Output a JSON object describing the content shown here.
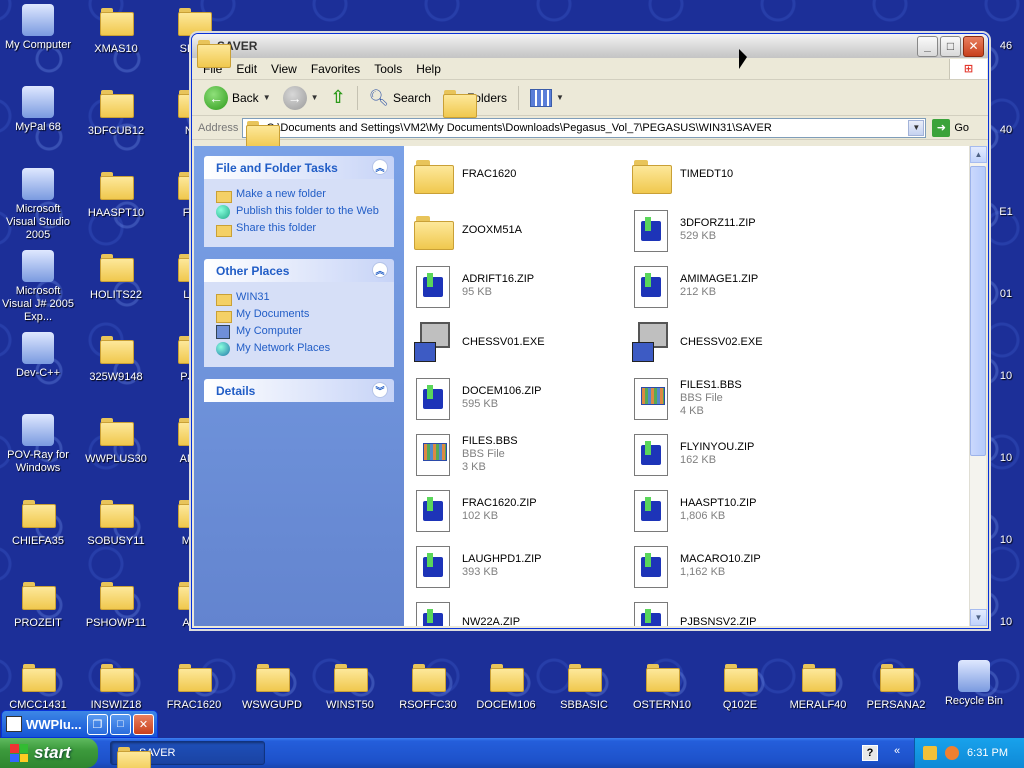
{
  "desktop": {
    "icons": [
      {
        "label": "My Computer"
      },
      {
        "label": "XMAS10"
      },
      {
        "label": "MyPal 68"
      },
      {
        "label": "3DFCUB12"
      },
      {
        "label": "Microsoft Visual Studio 2005"
      },
      {
        "label": "HAASPT10"
      },
      {
        "label": "Microsoft Visual J# 2005 Exp..."
      },
      {
        "label": "HOLITS22"
      },
      {
        "label": "Dev-C++"
      },
      {
        "label": "325W9148"
      },
      {
        "label": "POV-Ray for Windows"
      },
      {
        "label": "WWPLUS30"
      },
      {
        "label": "CHIEFA35"
      },
      {
        "label": "SOBUSY11"
      },
      {
        "label": "PROZEIT"
      },
      {
        "label": "PSHOWP11"
      },
      {
        "label": "CMCC1431"
      },
      {
        "label": "INSWIZ18"
      },
      {
        "label": "FRAC1620"
      },
      {
        "label": "WSWGUPD"
      },
      {
        "label": "WINST50"
      },
      {
        "label": "RSOFFC30"
      },
      {
        "label": "DOCEM106"
      },
      {
        "label": "SBBASIC"
      },
      {
        "label": "OSTERN10"
      },
      {
        "label": "Q102E"
      },
      {
        "label": "MERALF40"
      },
      {
        "label": "PERSANA2"
      },
      {
        "label": "Recycle Bin"
      },
      {
        "label": "SLSH"
      },
      {
        "label": "NW"
      },
      {
        "label": "FLYI"
      },
      {
        "label": "LAU"
      },
      {
        "label": "PJBS"
      },
      {
        "label": "AMIM"
      },
      {
        "label": "MAC"
      },
      {
        "label": "ADR"
      }
    ],
    "right_edge_labels": [
      "46",
      "40",
      "E1",
      "01",
      "10",
      "10",
      "10",
      "10"
    ]
  },
  "window": {
    "title": "SAVER",
    "menu": [
      "File",
      "Edit",
      "View",
      "Favorites",
      "Tools",
      "Help"
    ],
    "toolbar": {
      "back": "Back",
      "search": "Search",
      "folders": "Folders"
    },
    "address": {
      "label": "Address",
      "value": "C:\\Documents and Settings\\VM2\\My Documents\\Downloads\\Pegasus_Vol_7\\PEGASUS\\WIN31\\SAVER",
      "go": "Go"
    },
    "tasks_panel": {
      "title": "File and Folder Tasks",
      "items": [
        "Make a new folder",
        "Publish this folder to the Web",
        "Share this folder"
      ]
    },
    "places_panel": {
      "title": "Other Places",
      "items": [
        "WIN31",
        "My Documents",
        "My Computer",
        "My Network Places"
      ]
    },
    "details_panel": {
      "title": "Details"
    },
    "files": [
      {
        "name": "FRAC1620",
        "type": "folder",
        "meta1": "",
        "meta2": ""
      },
      {
        "name": "TIMEDT10",
        "type": "folder",
        "meta1": "",
        "meta2": ""
      },
      {
        "name": "ZOOXM51A",
        "type": "folder",
        "meta1": "",
        "meta2": ""
      },
      {
        "name": "3DFORZ11.ZIP",
        "type": "zip",
        "meta1": "529 KB",
        "meta2": ""
      },
      {
        "name": "ADRIFT16.ZIP",
        "type": "zip",
        "meta1": "95 KB",
        "meta2": ""
      },
      {
        "name": "AMIMAGE1.ZIP",
        "type": "zip",
        "meta1": "212 KB",
        "meta2": ""
      },
      {
        "name": "CHESSV01.EXE",
        "type": "exe",
        "meta1": "",
        "meta2": ""
      },
      {
        "name": "CHESSV02.EXE",
        "type": "exe",
        "meta1": "",
        "meta2": ""
      },
      {
        "name": "DOCEM106.ZIP",
        "type": "zip",
        "meta1": "595 KB",
        "meta2": ""
      },
      {
        "name": "FILES1.BBS",
        "type": "bbs",
        "meta1": "BBS File",
        "meta2": "4 KB"
      },
      {
        "name": "FILES.BBS",
        "type": "bbs",
        "meta1": "BBS File",
        "meta2": "3 KB"
      },
      {
        "name": "FLYINYOU.ZIP",
        "type": "zip",
        "meta1": "162 KB",
        "meta2": ""
      },
      {
        "name": "FRAC1620.ZIP",
        "type": "zip",
        "meta1": "102 KB",
        "meta2": ""
      },
      {
        "name": "HAASPT10.ZIP",
        "type": "zip",
        "meta1": "1,806 KB",
        "meta2": ""
      },
      {
        "name": "LAUGHPD1.ZIP",
        "type": "zip",
        "meta1": "393 KB",
        "meta2": ""
      },
      {
        "name": "MACARO10.ZIP",
        "type": "zip",
        "meta1": "1,162 KB",
        "meta2": ""
      },
      {
        "name": "NW22A.ZIP",
        "type": "zip",
        "meta1": "",
        "meta2": ""
      },
      {
        "name": "PJBSNSV2.ZIP",
        "type": "zip",
        "meta1": "",
        "meta2": ""
      }
    ]
  },
  "mini_window": {
    "title": "WWPlu..."
  },
  "taskbar": {
    "start": "start",
    "task": "SAVER",
    "clock": "6:31 PM",
    "help": "?"
  }
}
